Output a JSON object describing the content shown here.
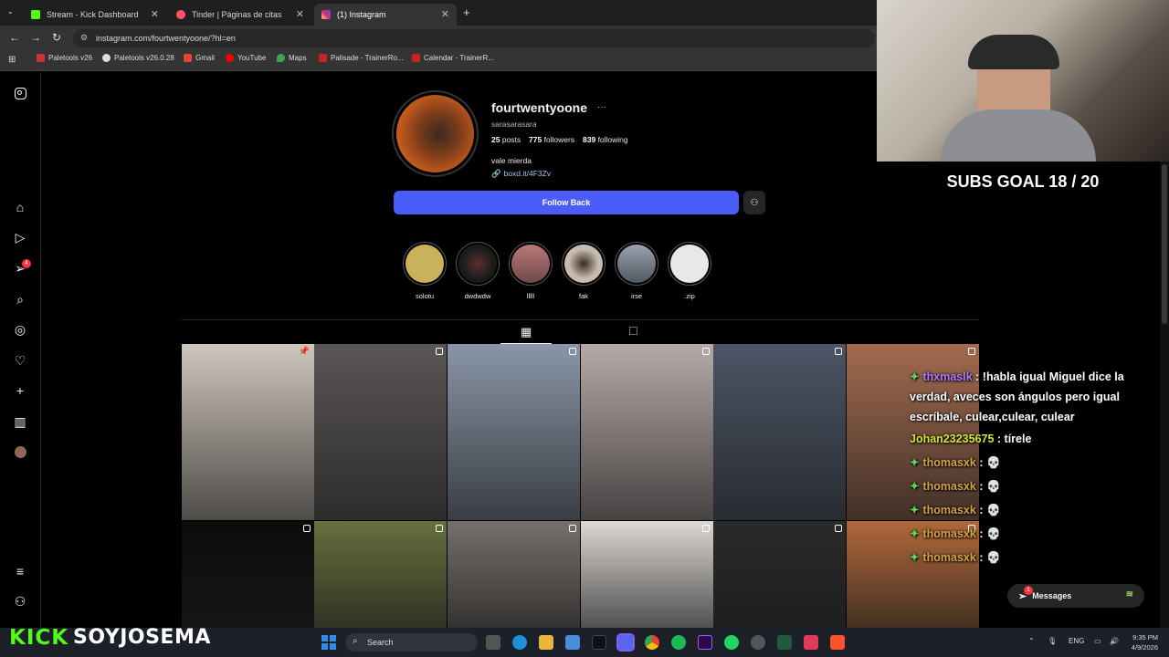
{
  "browser": {
    "tabs": [
      {
        "title": "Stream - Kick Dashboard",
        "color": "#53fc18"
      },
      {
        "title": "Tinder | Páginas de citas",
        "color": "#fd5564"
      },
      {
        "title": "(1) Instagram",
        "color": "#d62976"
      }
    ],
    "url": "instagram.com/fourtwentyoone/?hl=en",
    "bookmarks": [
      "Paletools v26",
      "Paletools v26.0.28",
      "Gmail",
      "YouTube",
      "Maps",
      "Palisade - TrainerRo...",
      "Calendar - TrainerR..."
    ]
  },
  "sidebar": {
    "icons": [
      "instagram-logo-icon",
      "home-icon",
      "reels-icon",
      "direct-icon",
      "search-icon",
      "explore-icon",
      "heart-icon",
      "create-icon",
      "dashboard-icon",
      "profile-avatar",
      "menu-icon",
      "meta-icon"
    ],
    "notification_badge": "4"
  },
  "profile": {
    "username": "fourtwentyoone",
    "full_name": "sarasarasara",
    "posts_count": "25",
    "posts_label": "posts",
    "followers_count": "775",
    "followers_label": "followers",
    "following_count": "839",
    "following_label": "following",
    "bio": "vale mierda",
    "link": "boxd.it/4F3Zv",
    "follow_button": "Follow Back"
  },
  "highlights": [
    {
      "label": "solotu",
      "color": "#c9b25a"
    },
    {
      "label": "dwdwdw",
      "color": "#1a1a1a"
    },
    {
      "label": "lllll",
      "color": "#a06060"
    },
    {
      "label": "fak",
      "color": "#c8bcb0"
    },
    {
      "label": "irse",
      "color": "#707a86"
    },
    {
      "label": ".zip",
      "color": "#e8e8e8"
    }
  ],
  "posts": [
    {
      "color": "#cfc7bd"
    },
    {
      "color": "#5b5656"
    },
    {
      "color": "#8a96a8"
    },
    {
      "color": "#b6aaa8"
    },
    {
      "color": "#4c5566"
    },
    {
      "color": "#a26a4e"
    },
    {
      "color": "#0c0c0c"
    },
    {
      "color": "#66703d"
    },
    {
      "color": "#77706c"
    },
    {
      "color": "#dcd8d4"
    },
    {
      "color": "#2a2a2a"
    },
    {
      "color": "#b0683a"
    }
  ],
  "overlay": {
    "subs_goal": "SUBS GOAL 18 / 20",
    "chat": [
      {
        "user": "thxmaslk",
        "text": "!habla igual Miguel dice la verdad, aveces son ángulos pero igual escríbale, culear,culear, culear"
      },
      {
        "user": "Johan23235675",
        "text": "tírele"
      },
      {
        "user": "thomasxk",
        "text": "💀"
      },
      {
        "user": "thomasxk",
        "text": "💀"
      },
      {
        "user": "thomasxk",
        "text": "💀"
      },
      {
        "user": "thomasxk",
        "text": "💀"
      },
      {
        "user": "thomasxk",
        "text": "💀"
      }
    ],
    "messages_label": "Messages",
    "messages_badge": "1",
    "kick_label": "KICK",
    "streamer_name": "SOYJOSEMA"
  },
  "taskbar": {
    "search": "Search",
    "lang": "ENG",
    "time": "9:35 PM",
    "date": "4/9/2026"
  }
}
